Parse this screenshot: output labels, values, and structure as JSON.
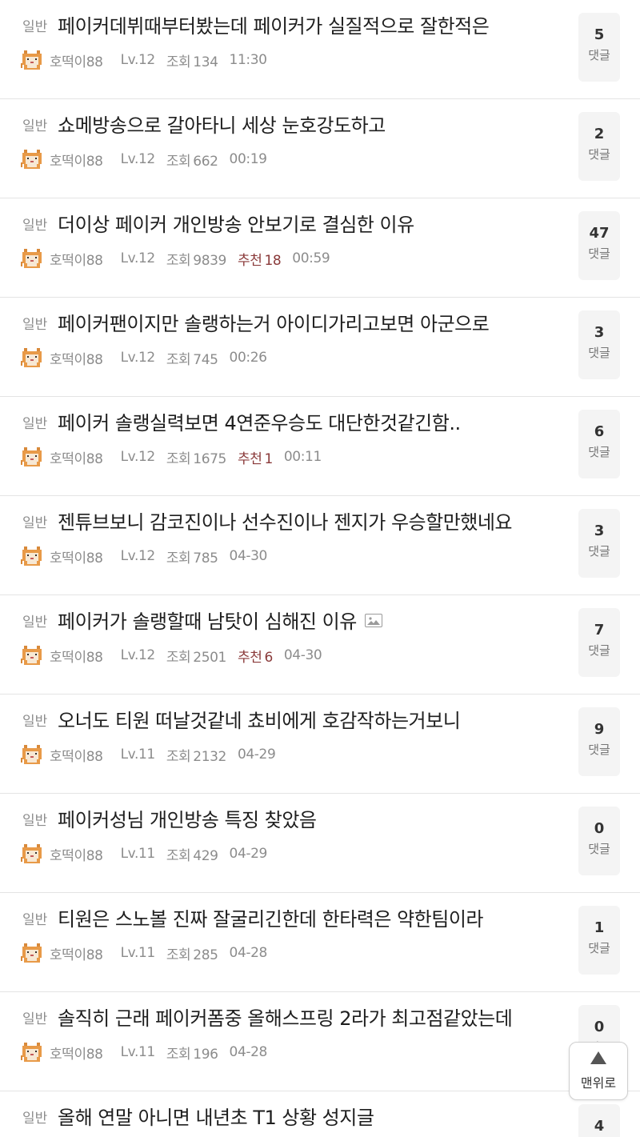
{
  "comment_label": "댓글",
  "views_label": "조회",
  "rec_label": "추천",
  "top_button_label": "맨위로",
  "posts": [
    {
      "category": "일반",
      "title": "페이커데뷔때부터봤는데 페이커가 실질적으로 잘한적은",
      "author": "호떡이88",
      "level": "Lv.12",
      "views": "134",
      "rec": "",
      "time": "11:30",
      "comments": "5",
      "has_image": false
    },
    {
      "category": "일반",
      "title": "쇼메방송으로 갈아타니 세상 눈호강도하고",
      "author": "호떡이88",
      "level": "Lv.12",
      "views": "662",
      "rec": "",
      "time": "00:19",
      "comments": "2",
      "has_image": false
    },
    {
      "category": "일반",
      "title": "더이상 페이커 개인방송 안보기로 결심한 이유",
      "author": "호떡이88",
      "level": "Lv.12",
      "views": "9839",
      "rec": "18",
      "time": "00:59",
      "comments": "47",
      "has_image": false
    },
    {
      "category": "일반",
      "title": "페이커팬이지만 솔랭하는거 아이디가리고보면 아군으로",
      "author": "호떡이88",
      "level": "Lv.12",
      "views": "745",
      "rec": "",
      "time": "00:26",
      "comments": "3",
      "has_image": false
    },
    {
      "category": "일반",
      "title": "페이커 솔랭실력보면 4연준우승도 대단한것같긴함..",
      "author": "호떡이88",
      "level": "Lv.12",
      "views": "1675",
      "rec": "1",
      "time": "00:11",
      "comments": "6",
      "has_image": false
    },
    {
      "category": "일반",
      "title": "젠튜브보니 감코진이나 선수진이나 젠지가 우승할만했네요",
      "author": "호떡이88",
      "level": "Lv.12",
      "views": "785",
      "rec": "",
      "time": "04-30",
      "comments": "3",
      "has_image": false
    },
    {
      "category": "일반",
      "title": "페이커가 솔랭할때 남탓이 심해진 이유",
      "author": "호떡이88",
      "level": "Lv.12",
      "views": "2501",
      "rec": "6",
      "time": "04-30",
      "comments": "7",
      "has_image": true
    },
    {
      "category": "일반",
      "title": "오너도 티원 떠날것같네 쵸비에게 호감작하는거보니",
      "author": "호떡이88",
      "level": "Lv.11",
      "views": "2132",
      "rec": "",
      "time": "04-29",
      "comments": "9",
      "has_image": false
    },
    {
      "category": "일반",
      "title": "페이커성님 개인방송 특징 찾았음",
      "author": "호떡이88",
      "level": "Lv.11",
      "views": "429",
      "rec": "",
      "time": "04-29",
      "comments": "0",
      "has_image": false
    },
    {
      "category": "일반",
      "title": "티원은 스노볼 진짜 잘굴리긴한데 한타력은 약한팀이라",
      "author": "호떡이88",
      "level": "Lv.11",
      "views": "285",
      "rec": "",
      "time": "04-28",
      "comments": "1",
      "has_image": false
    },
    {
      "category": "일반",
      "title": "솔직히 근래 페이커폼중 올해스프링 2라가 최고점같았는데",
      "author": "호떡이88",
      "level": "Lv.11",
      "views": "196",
      "rec": "",
      "time": "04-28",
      "comments": "0",
      "has_image": false
    },
    {
      "category": "일반",
      "title": "올해 연말 아니면 내년초 T1 상황 성지글",
      "author": "",
      "level": "",
      "views": "",
      "rec": "",
      "time": "",
      "comments": "4",
      "has_image": false
    }
  ]
}
